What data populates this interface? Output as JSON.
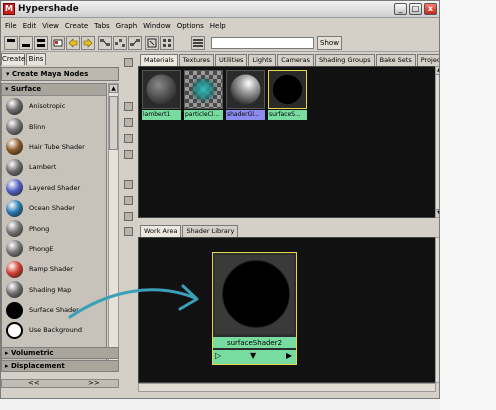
{
  "window": {
    "title": "Hypershade",
    "controls": {
      "minimize": "_",
      "maximize": "□",
      "close": "x"
    }
  },
  "menu": [
    "File",
    "Edit",
    "View",
    "Create",
    "Tabs",
    "Graph",
    "Window",
    "Options",
    "Help"
  ],
  "toolbar": {
    "filter_value": "",
    "show_label": "Show",
    "icons": [
      "layout-top-icon",
      "layout-bottom-icon",
      "layout-both-icon",
      "bookmark-icon",
      "prev-graph-icon",
      "next-graph-icon",
      "graph-input-icon",
      "graph-input-output-icon",
      "graph-output-icon",
      "clear-graph-icon",
      "rearrange-graph-icon"
    ]
  },
  "left_panel": {
    "tabs": [
      "Create",
      "Bins"
    ],
    "header": "Create Maya Nodes",
    "section": "Surface",
    "shaders": [
      {
        "name": "Anisotropic",
        "icon": "anisotropic-shader-icon",
        "color": "#6a6a6a"
      },
      {
        "name": "Blinn",
        "icon": "blinn-shader-icon",
        "color": "#727272"
      },
      {
        "name": "Hair Tube Shader",
        "icon": "hair-tube-shader-icon",
        "color": "#8a5a2a"
      },
      {
        "name": "Lambert",
        "icon": "lambert-shader-icon",
        "color": "#6e6e6e"
      },
      {
        "name": "Layered Shader",
        "icon": "layered-shader-icon",
        "color": "#5060c0"
      },
      {
        "name": "Ocean Shader",
        "icon": "ocean-shader-icon",
        "color": "#2a7ab0"
      },
      {
        "name": "Phong",
        "icon": "phong-shader-icon",
        "color": "#777777"
      },
      {
        "name": "PhongE",
        "icon": "phonge-shader-icon",
        "color": "#777777"
      },
      {
        "name": "Ramp Shader",
        "icon": "ramp-shader-icon",
        "color": "#d04030"
      },
      {
        "name": "Shading Map",
        "icon": "shading-map-icon",
        "color": "#707070"
      },
      {
        "name": "Surface Shader",
        "icon": "surface-shader-icon",
        "color": "#000000"
      },
      {
        "name": "Use Background",
        "icon": "use-background-icon",
        "color": "#ffffff"
      }
    ],
    "collapsed_sections": [
      "Volumetric",
      "Displacement"
    ],
    "nav": {
      "prev": "<<",
      "next": ">>"
    }
  },
  "top_tabs": [
    "Materials",
    "Textures",
    "Utilities",
    "Lights",
    "Cameras",
    "Shading Groups",
    "Bake Sets",
    "Projects"
  ],
  "materials": [
    {
      "label": "lambert1",
      "label_color": "#78dca0",
      "icon": "lambert1-material-icon",
      "selected": false
    },
    {
      "label": "particleCl...",
      "label_color": "#78dca0",
      "icon": "particle-cloud-material-icon",
      "selected": false
    },
    {
      "label": "shaderGl...",
      "label_color": "#8c8cf0",
      "icon": "shader-glow-material-icon",
      "selected": false
    },
    {
      "label": "surfaceS...",
      "label_color": "#78dca0",
      "icon": "surface-shader-material-icon",
      "selected": true
    }
  ],
  "bottom_tabs": [
    "Work Area",
    "Shader Library"
  ],
  "work_node": {
    "label": "surfaceShader2",
    "ports": [
      "▷",
      "▼",
      "▶"
    ]
  }
}
